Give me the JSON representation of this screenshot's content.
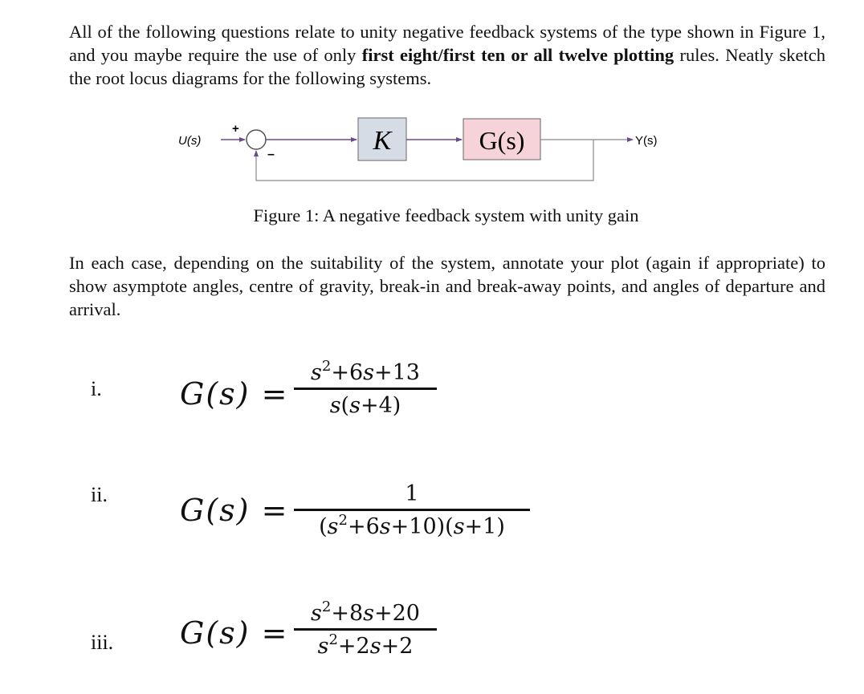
{
  "intro": {
    "part1": "All of the following questions relate to unity negative feedback systems of the type shown in Figure 1, and you maybe require the use of only ",
    "bold": "first eight/first ten or all twelve plotting",
    "part2": " rules. Neatly sketch the root locus diagrams for the following systems."
  },
  "figure": {
    "input_label": "U(s)",
    "output_label": "Y(s)",
    "plus_sign": "+",
    "minus_sign": "–",
    "gain_block": "K",
    "plant_block": "G(s)",
    "caption": "Figure 1: A negative feedback system with unity gain",
    "colors": {
      "gain_fill": "#d6dce6",
      "plant_fill": "#f6d2d9",
      "wire": "#6a4a8a"
    }
  },
  "instructions": "In each case, depending on the suitability of the system, annotate your plot (again if appropriate) to show asymptote angles, centre of gravity, break-in and break-away points, and angles of departure and arrival.",
  "problems": [
    {
      "label": "i.",
      "lhs": "G(s) =",
      "numerator": "s²+6s+13",
      "denominator": "s(s+4)"
    },
    {
      "label": "ii.",
      "lhs": "G(s) =",
      "numerator": "1",
      "denominator": "(s²+6s+10)(s+1)"
    },
    {
      "label": "iii.",
      "lhs": "G(s) =",
      "numerator": "s²+8s+20",
      "denominator": "s²+2s+2"
    }
  ]
}
